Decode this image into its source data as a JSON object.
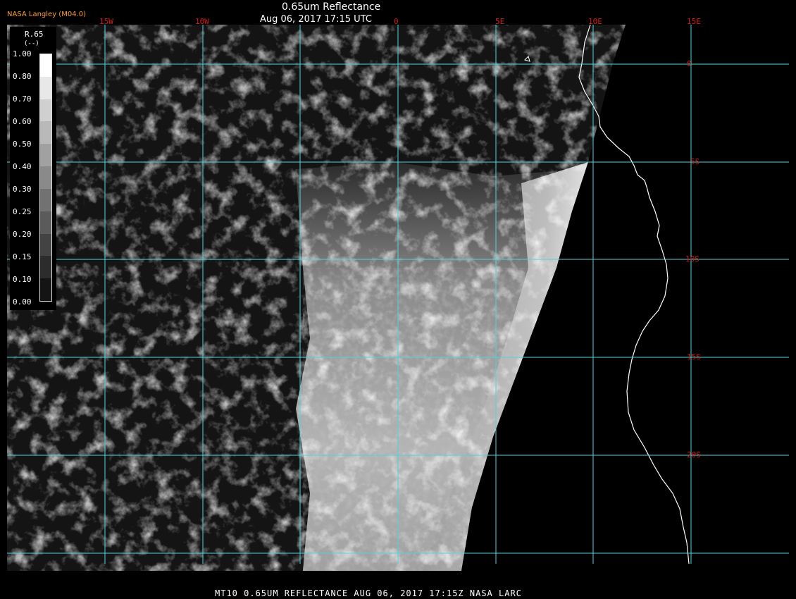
{
  "header": {
    "credit": "NASA Langley (M04.0)",
    "title": "0.65um Reflectance",
    "subtitle": "Aug 06, 2017 17:15 UTC"
  },
  "footer": {
    "caption": "MT10  0.65UM REFLECTANCE   AUG 06, 2017 17:15Z   NASA LARC"
  },
  "legend": {
    "label": "R.65",
    "unit": "(--)",
    "values": [
      "1.00",
      "0.80",
      "0.70",
      "0.60",
      "0.50",
      "0.40",
      "0.30",
      "0.25",
      "0.20",
      "0.15",
      "0.10",
      "0.00"
    ]
  },
  "grid": {
    "lon_labels": [
      "15W",
      "10W",
      "0",
      "5E",
      "10E",
      "15E"
    ],
    "lat_labels": [
      "0",
      "5S",
      "10S",
      "15S",
      "20S"
    ]
  },
  "colors": {
    "grid_line": "#4fd5dd",
    "tick_label": "#d11b1b",
    "coastline": "#ffffff",
    "credit": "#ff9f2a"
  }
}
